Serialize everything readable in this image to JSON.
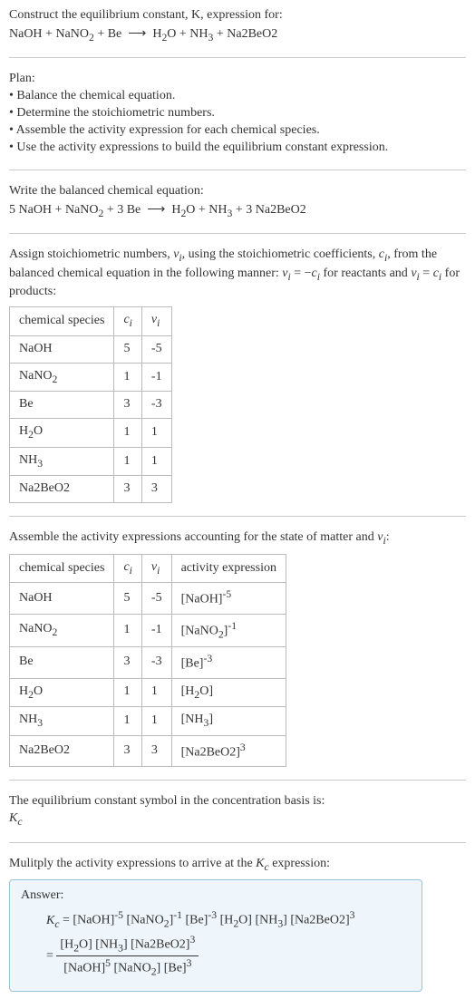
{
  "header": {
    "prompt": "Construct the equilibrium constant, K, expression for:",
    "equation_html": "NaOH + NaNO<sub>2</sub> + Be &nbsp;⟶&nbsp; H<sub>2</sub>O + NH<sub>3</sub> + Na2BeO2"
  },
  "plan": {
    "title": "Plan:",
    "items": [
      "Balance the chemical equation.",
      "Determine the stoichiometric numbers.",
      "Assemble the activity expression for each chemical species.",
      "Use the activity expressions to build the equilibrium constant expression."
    ]
  },
  "balanced": {
    "intro": "Write the balanced chemical equation:",
    "equation_html": "5 NaOH + NaNO<sub>2</sub> + 3 Be &nbsp;⟶&nbsp; H<sub>2</sub>O + NH<sub>3</sub> + 3 Na2BeO2"
  },
  "stoich_intro_html": "Assign stoichiometric numbers, <i>ν<sub>i</sub></i>, using the stoichiometric coefficients, <i>c<sub>i</sub></i>, from the balanced chemical equation in the following manner: <i>ν<sub>i</sub></i> = −<i>c<sub>i</sub></i> for reactants and <i>ν<sub>i</sub></i> = <i>c<sub>i</sub></i> for products:",
  "stoich_table": {
    "headers": [
      "chemical species",
      "c_i",
      "ν_i"
    ],
    "rows": [
      {
        "species_html": "NaOH",
        "c": "5",
        "nu": "-5"
      },
      {
        "species_html": "NaNO<sub>2</sub>",
        "c": "1",
        "nu": "-1"
      },
      {
        "species_html": "Be",
        "c": "3",
        "nu": "-3"
      },
      {
        "species_html": "H<sub>2</sub>O",
        "c": "1",
        "nu": "1"
      },
      {
        "species_html": "NH<sub>3</sub>",
        "c": "1",
        "nu": "1"
      },
      {
        "species_html": "Na2BeO2",
        "c": "3",
        "nu": "3"
      }
    ]
  },
  "activity_intro_html": "Assemble the activity expressions accounting for the state of matter and <i>ν<sub>i</sub></i>:",
  "activity_table": {
    "headers": [
      "chemical species",
      "c_i",
      "ν_i",
      "activity expression"
    ],
    "rows": [
      {
        "species_html": "NaOH",
        "c": "5",
        "nu": "-5",
        "act_html": "[NaOH]<sup>-5</sup>"
      },
      {
        "species_html": "NaNO<sub>2</sub>",
        "c": "1",
        "nu": "-1",
        "act_html": "[NaNO<sub>2</sub>]<sup>-1</sup>"
      },
      {
        "species_html": "Be",
        "c": "3",
        "nu": "-3",
        "act_html": "[Be]<sup>-3</sup>"
      },
      {
        "species_html": "H<sub>2</sub>O",
        "c": "1",
        "nu": "1",
        "act_html": "[H<sub>2</sub>O]"
      },
      {
        "species_html": "NH<sub>3</sub>",
        "c": "1",
        "nu": "1",
        "act_html": "[NH<sub>3</sub>]"
      },
      {
        "species_html": "Na2BeO2",
        "c": "3",
        "nu": "3",
        "act_html": "[Na2BeO2]<sup>3</sup>"
      }
    ]
  },
  "kc_line1": "The equilibrium constant symbol in the concentration basis is:",
  "kc_symbol_html": "<i>K<sub>c</sub></i>",
  "multiply_line_html": "Mulitply the activity expressions to arrive at the <i>K<sub>c</sub></i> expression:",
  "answer": {
    "label": "Answer:",
    "line1_html": "<i>K<sub>c</sub></i> = [NaOH]<sup>-5</sup> [NaNO<sub>2</sub>]<sup>-1</sup> [Be]<sup>-3</sup> [H<sub>2</sub>O] [NH<sub>3</sub>] [Na2BeO2]<sup>3</sup>",
    "frac_num_html": "[H<sub>2</sub>O] [NH<sub>3</sub>] [Na2BeO2]<sup>3</sup>",
    "frac_den_html": "[NaOH]<sup>5</sup> [NaNO<sub>2</sub>] [Be]<sup>3</sup>"
  },
  "chart_data": {
    "type": "table",
    "tables": [
      {
        "title": "Stoichiometric numbers",
        "columns": [
          "chemical species",
          "c_i",
          "nu_i"
        ],
        "rows": [
          [
            "NaOH",
            5,
            -5
          ],
          [
            "NaNO2",
            1,
            -1
          ],
          [
            "Be",
            3,
            -3
          ],
          [
            "H2O",
            1,
            1
          ],
          [
            "NH3",
            1,
            1
          ],
          [
            "Na2BeO2",
            3,
            3
          ]
        ]
      },
      {
        "title": "Activity expressions",
        "columns": [
          "chemical species",
          "c_i",
          "nu_i",
          "activity expression"
        ],
        "rows": [
          [
            "NaOH",
            5,
            -5,
            "[NaOH]^-5"
          ],
          [
            "NaNO2",
            1,
            -1,
            "[NaNO2]^-1"
          ],
          [
            "Be",
            3,
            -3,
            "[Be]^-3"
          ],
          [
            "H2O",
            1,
            1,
            "[H2O]"
          ],
          [
            "NH3",
            1,
            1,
            "[NH3]"
          ],
          [
            "Na2BeO2",
            3,
            3,
            "[Na2BeO2]^3"
          ]
        ]
      }
    ]
  }
}
